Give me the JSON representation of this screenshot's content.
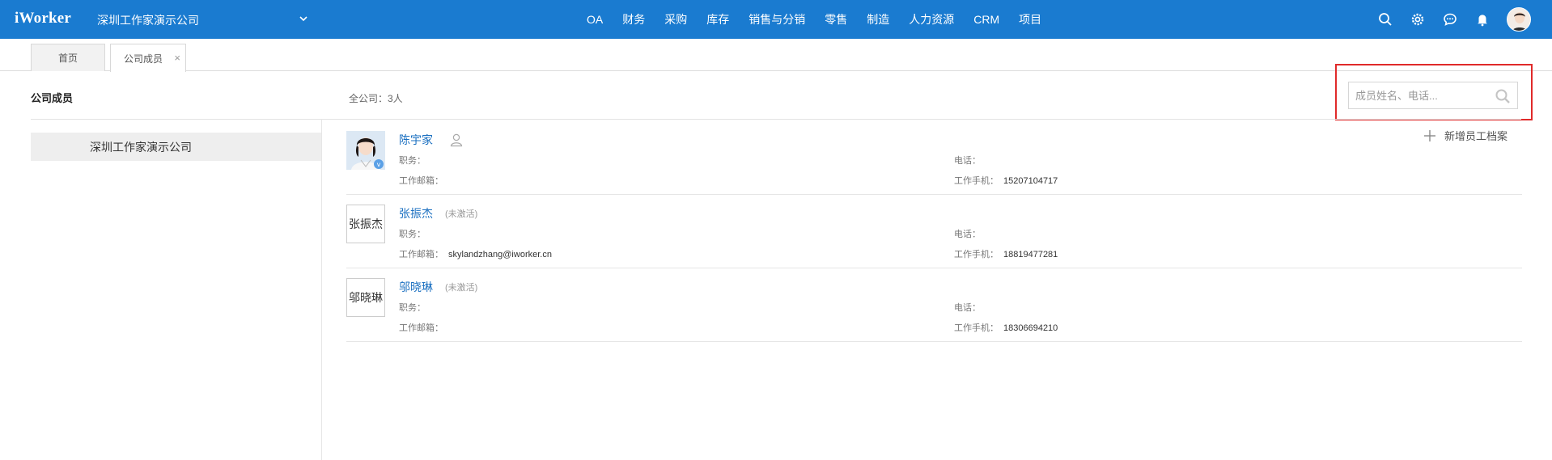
{
  "header": {
    "logo": "iWorker",
    "company": "深圳工作家演示公司",
    "nav": [
      "OA",
      "财务",
      "采购",
      "库存",
      "销售与分销",
      "零售",
      "制造",
      "人力资源",
      "CRM",
      "项目"
    ],
    "icons": [
      "search-icon",
      "gear-icon",
      "chat-icon",
      "bell-icon",
      "avatar"
    ],
    "accent_color": "#1a7bd0"
  },
  "tabs": [
    {
      "label": "首页",
      "active": false
    },
    {
      "label": "公司成员",
      "active": true,
      "close": "×"
    }
  ],
  "page": {
    "title": "公司成员",
    "company_count": "全公司：3人",
    "search_placeholder": "成员姓名、电话...",
    "add_profile": "新增员工档案",
    "highlight_color": "#e02a2a"
  },
  "tree": {
    "items": [
      {
        "label": "深圳工作家演示公司",
        "selected": true
      }
    ]
  },
  "labels": {
    "position": "职务：",
    "email": "工作邮箱：",
    "phone": "电话：",
    "mobile": "工作手机："
  },
  "members": [
    {
      "name": "陈宇家",
      "status": "",
      "avatar_alt": "",
      "position": "",
      "email": "",
      "phone": "",
      "mobile": "15207104717"
    },
    {
      "name": "张振杰",
      "status": "(未激活)",
      "avatar_alt": "张振杰",
      "position": "",
      "email": "skylandzhang@iworker.cn",
      "phone": "",
      "mobile": "18819477281"
    },
    {
      "name": "邬晓琳",
      "status": "(未激活)",
      "avatar_alt": "邬晓琳",
      "position": "",
      "email": "",
      "phone": "",
      "mobile": "18306694210"
    }
  ]
}
